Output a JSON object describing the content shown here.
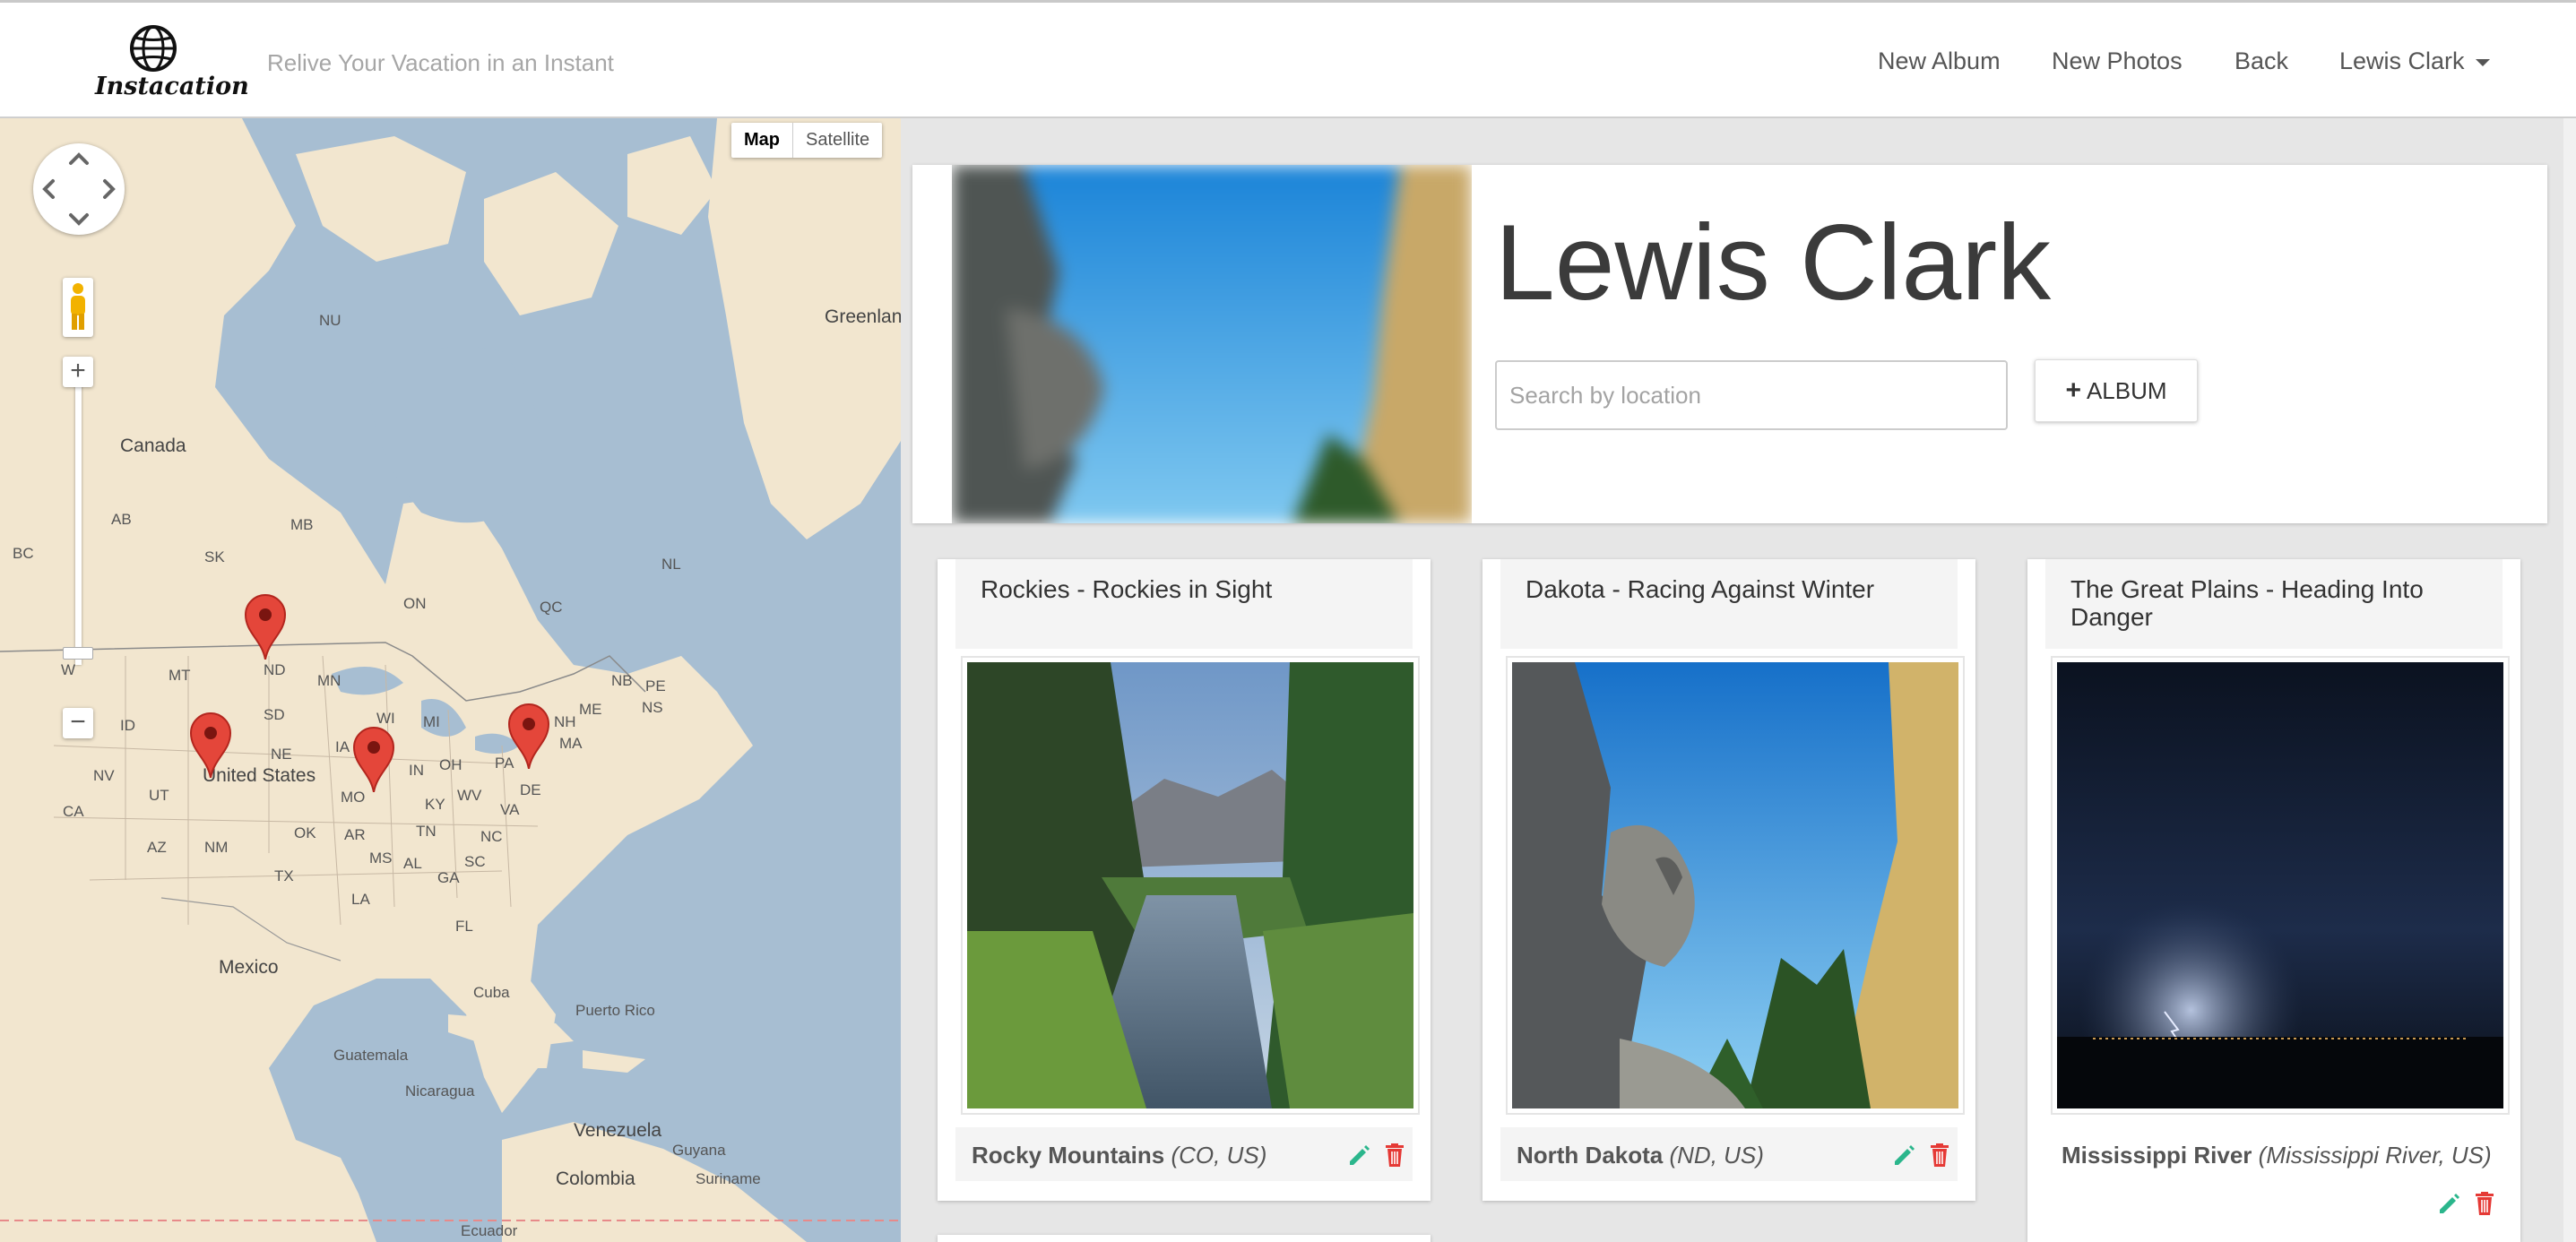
{
  "header": {
    "logo_text": "Instacation",
    "tagline": "Relive Your Vacation in an Instant",
    "nav": {
      "new_album": "New Album",
      "new_photos": "New Photos",
      "back": "Back",
      "user": "Lewis Clark"
    }
  },
  "map": {
    "type_buttons": {
      "map": "Map",
      "satellite": "Satellite"
    },
    "selected_type": "Map",
    "zoom_in": "+",
    "zoom_out": "−",
    "labels": {
      "greenland": "Greenland",
      "canada": "Canada",
      "nu": "NU",
      "ab": "AB",
      "bc": "BC",
      "sk": "SK",
      "mb": "MB",
      "on": "ON",
      "qc": "QC",
      "nl": "NL",
      "nb": "NB",
      "pe": "PE",
      "ns": "NS",
      "wa": "W",
      "mt": "MT",
      "nd": "ND",
      "mn": "MN",
      "id": "ID",
      "sd": "SD",
      "wi": "WI",
      "mi": "MI",
      "nh": "NH",
      "me": "ME",
      "ma": "MA",
      "nv": "NV",
      "ne": "NE",
      "ia": "IA",
      "in": "IN",
      "oh": "OH",
      "pa": "PA",
      "de": "DE",
      "ca": "CA",
      "ut": "UT",
      "us": "United States",
      "mo": "MO",
      "ky": "KY",
      "wv": "WV",
      "va": "VA",
      "az": "AZ",
      "nm": "NM",
      "ok": "OK",
      "ar": "AR",
      "tn": "TN",
      "nc": "NC",
      "tx": "TX",
      "ms": "MS",
      "al": "AL",
      "sc": "SC",
      "ga": "GA",
      "la": "LA",
      "fl": "FL",
      "mexico": "Mexico",
      "cuba": "Cuba",
      "puerto_rico": "Puerto Rico",
      "guatemala": "Guatemala",
      "nicaragua": "Nicaragua",
      "venezuela": "Venezuela",
      "guyana": "Guyana",
      "suriname": "Suriname",
      "colombia": "Colombia",
      "ecuador": "Ecuador"
    },
    "markers": [
      "Rockies",
      "Dakota",
      "Mississippi",
      "Northeast"
    ],
    "colors": {
      "land": "#f2e6cf",
      "water": "#a7bed2",
      "marker": "#e4463a"
    }
  },
  "profile": {
    "name": "Lewis Clark",
    "search_placeholder": "Search by location",
    "album_button": "ALBUM"
  },
  "albums": [
    {
      "title": "Rockies - Rockies in Sight",
      "location_name": "Rocky Mountains",
      "location_region": "(CO, US)"
    },
    {
      "title": "Dakota - Racing Against Winter",
      "location_name": "North Dakota",
      "location_region": "(ND, US)"
    },
    {
      "title": "The Great Plains - Heading Into Danger",
      "location_name": "Mississippi River",
      "location_region": "(Mississippi River, US)"
    }
  ],
  "colors": {
    "edit_icon": "#2bb68c",
    "delete_icon": "#e53935"
  }
}
